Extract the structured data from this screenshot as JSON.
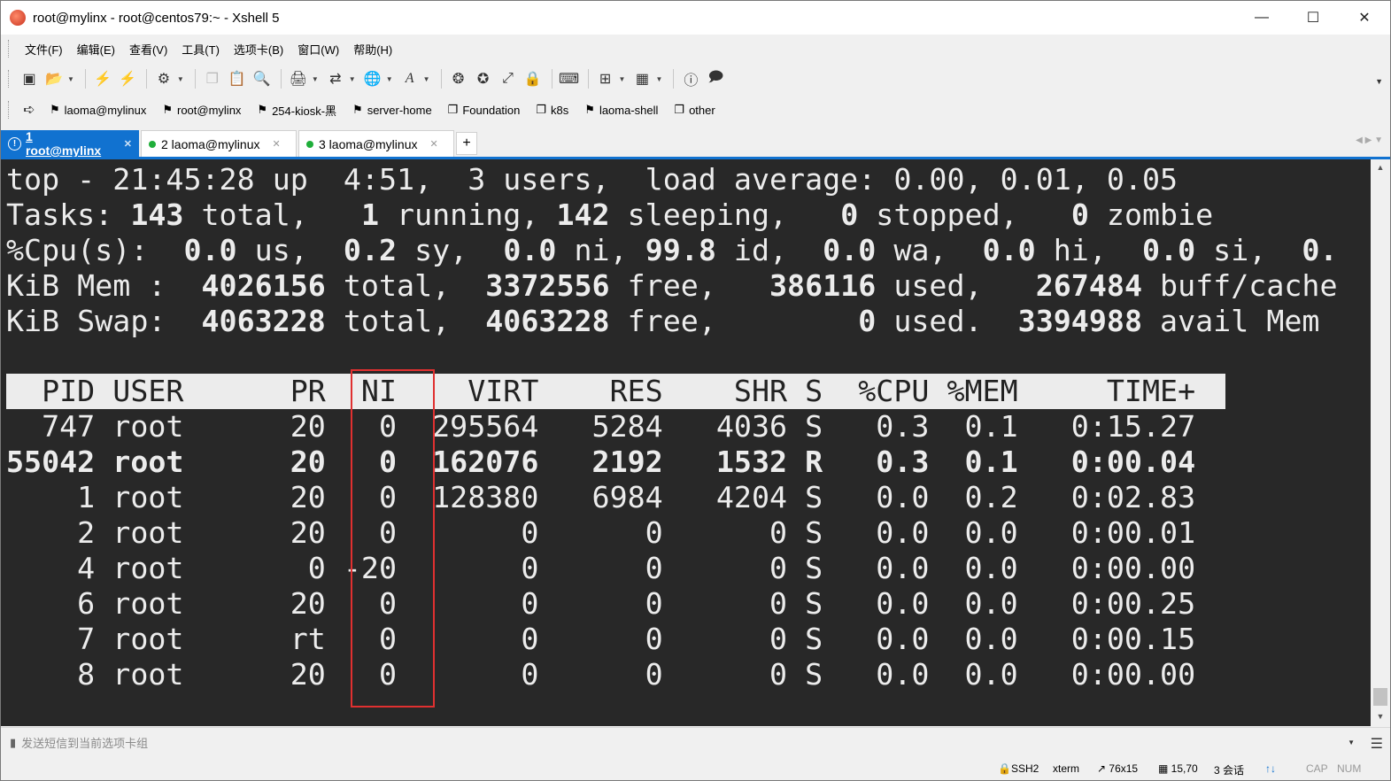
{
  "window": {
    "title": "root@mylinx - root@centos79:~ - Xshell 5"
  },
  "menu": [
    "文件(F)",
    "编辑(E)",
    "查看(V)",
    "工具(T)",
    "选项卡(B)",
    "窗口(W)",
    "帮助(H)"
  ],
  "links": [
    {
      "label": "laoma@mylinux",
      "icon": "bookmark-icon"
    },
    {
      "label": "root@mylinx",
      "icon": "bookmark-icon"
    },
    {
      "label": "254-kiosk-黑",
      "icon": "bookmark-icon"
    },
    {
      "label": "server-home",
      "icon": "bookmark-icon"
    },
    {
      "label": "Foundation",
      "icon": "folder-group-icon"
    },
    {
      "label": "k8s",
      "icon": "folder-group-icon"
    },
    {
      "label": "laoma-shell",
      "icon": "bookmark-icon"
    },
    {
      "label": "other",
      "icon": "folder-group-icon"
    }
  ],
  "tabs": [
    {
      "label": "1 root@mylinx",
      "active": true
    },
    {
      "label": "2 laoma@mylinux",
      "active": false
    },
    {
      "label": "3 laoma@mylinux",
      "active": false
    }
  ],
  "terminal": {
    "summary": [
      "top - 21:45:28 up  4:51,  3 users,  load average: 0.00, 0.01, 0.05",
      "Tasks: 143 total,   1 running, 142 sleeping,   0 stopped,   0 zombie",
      "%Cpu(s):  0.0 us,  0.2 sy,  0.0 ni, 99.8 id,  0.0 wa,  0.0 hi,  0.0 si,  0.",
      "KiB Mem :  4026156 total,  3372556 free,   386116 used,   267484 buff/cache",
      "KiB Swap:  4063228 total,  4063228 free,        0 used.  3394988 avail Mem"
    ],
    "header": "  PID USER      PR  NI    VIRT    RES    SHR S  %CPU %MEM     TIME+",
    "rows": [
      {
        "text": "  747 root      20   0  295564   5284   4036 S   0.3  0.1   0:15.27",
        "bold": false
      },
      {
        "text": "55042 root      20   0  162076   2192   1532 R   0.3  0.1   0:00.04",
        "bold": true
      },
      {
        "text": "    1 root      20   0  128380   6984   4204 S   0.0  0.2   0:02.83",
        "bold": false
      },
      {
        "text": "    2 root      20   0       0      0      0 S   0.0  0.0   0:00.01",
        "bold": false
      },
      {
        "text": "    4 root       0 -20       0      0      0 S   0.0  0.0   0:00.00",
        "bold": false
      },
      {
        "text": "    6 root      20   0       0      0      0 S   0.0  0.0   0:00.25",
        "bold": false
      },
      {
        "text": "    7 root      rt   0       0      0      0 S   0.0  0.0   0:00.15",
        "bold": false
      },
      {
        "text": "    8 root      20   0       0      0      0 S   0.0  0.0   0:00.00",
        "bold": false
      }
    ],
    "bold_tokens": [
      "143",
      "1",
      "142",
      "0",
      "0.0",
      "0.2",
      "99.8",
      "4026156",
      "3372556",
      "386116",
      "267484",
      "4063228",
      "3394988"
    ]
  },
  "compose": {
    "placeholder": "发送短信到当前选项卡组"
  },
  "status": {
    "protocol": "SSH2",
    "term": "xterm",
    "size": "76x15",
    "cursor": "15,70",
    "sessions": "3 会话",
    "cap": "CAP",
    "num": "NUM"
  },
  "colors": {
    "accent": "#1172d0",
    "terminal_bg": "#282828",
    "terminal_fg": "#ececec",
    "highlight": "#e03030"
  }
}
